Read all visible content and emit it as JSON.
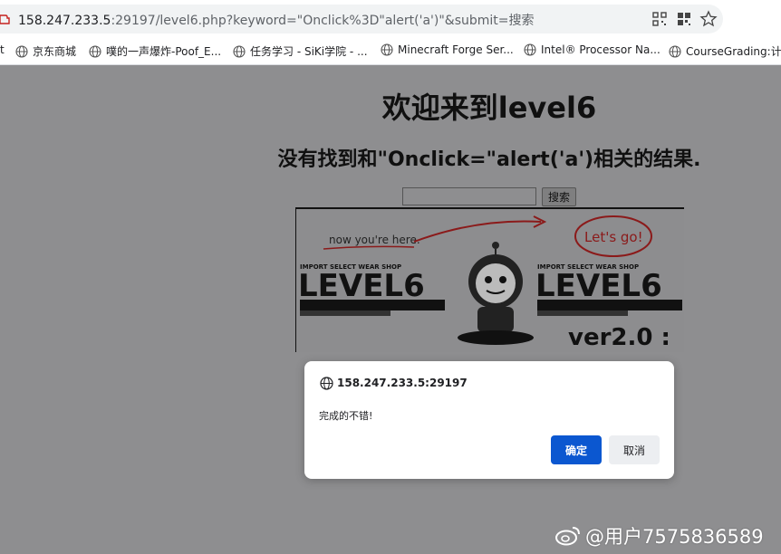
{
  "browser": {
    "url_host": "158.247.233.5",
    "url_rest": ":29197/level6.php?keyword=\"Onclick%3D\"alert('a')\"&submit=搜索",
    "toolbar_icons": [
      "qr-icon",
      "grid-icon",
      "star-icon"
    ]
  },
  "bookmarks": [
    {
      "label": "t",
      "icon": "none"
    },
    {
      "label": "京东商城",
      "icon": "globe-icon"
    },
    {
      "label": "噗的一声爆炸-Poof_E...",
      "icon": "globe-icon"
    },
    {
      "label": "任务学习 - SiKi学院 - ...",
      "icon": "globe-icon"
    },
    {
      "label": "Minecraft Forge Ser...",
      "icon": "globe-icon"
    },
    {
      "label": "Intel® Processor Na...",
      "icon": "globe-icon"
    },
    {
      "label": "CourseGrading:计算",
      "icon": "globe-icon"
    }
  ],
  "page": {
    "title": "欢迎来到level6",
    "result_text": "没有找到和\"Onclick=\"alert('a')相关的结果.",
    "search_value": "",
    "search_button": "搜索"
  },
  "banner": {
    "note_left": "now you're here.",
    "note_right": "Let's go!",
    "shop_left": "IMPORT SELECT WEAR SHOP",
    "logo_left": "LEVEL6",
    "shop_right": "IMPORT SELECT WEAR SHOP",
    "logo_right": "LEVEL6",
    "version": "ver2.0 :"
  },
  "dialog": {
    "origin": "158.247.233.5:29197",
    "message": "完成的不错!",
    "ok_label": "确定",
    "cancel_label": "取消",
    "accent": "#0b57d0"
  },
  "watermark": {
    "text": "@用户7575836589"
  }
}
